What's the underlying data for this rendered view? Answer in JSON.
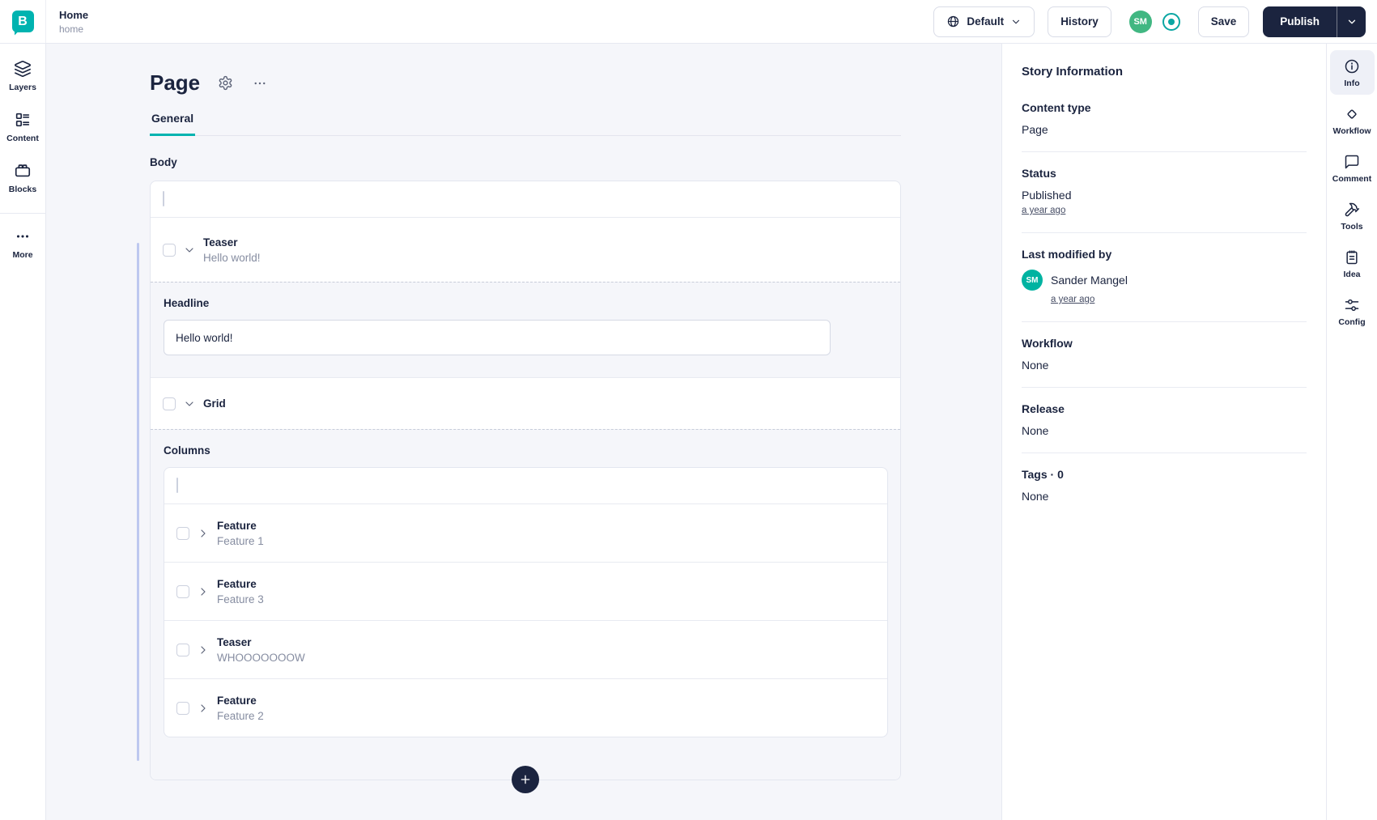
{
  "colors": {
    "brand_teal": "#00b3b0",
    "navy": "#1b243f",
    "avatar_green": "#41b782",
    "avatar_teal": "#00b3a1",
    "main_background": "#f5f6fa",
    "active_tab_underline": "#00b3b0"
  },
  "icons": {
    "topbar": [
      "storyblok-logo",
      "globe-icon",
      "chevron-down-icon",
      "target-icon"
    ],
    "left_rail": [
      "layers-icon",
      "content-icon",
      "blocks-icon",
      "more-icon"
    ],
    "editor": [
      "gear-icon",
      "ellipsis-icon",
      "chevron-down-icon",
      "chevron-right-icon",
      "plus-icon"
    ],
    "right_rail": [
      "info-icon",
      "workflow-icon",
      "comment-icon",
      "tools-icon",
      "idea-icon",
      "config-icon"
    ]
  },
  "topbar": {
    "logo_letter": "B",
    "story_title": "Home",
    "story_slug": "home",
    "language_label": "Default",
    "history_label": "History",
    "avatar_initials": "SM",
    "save_label": "Save",
    "publish_label": "Publish"
  },
  "left_rail": {
    "layers_label": "Layers",
    "content_label": "Content",
    "blocks_label": "Blocks",
    "more_label": "More"
  },
  "editor": {
    "title": "Page",
    "active_tab": "General",
    "body_label": "Body",
    "teaser_block": {
      "title": "Teaser",
      "subtitle": "Hello world!"
    },
    "headline_field": {
      "label": "Headline",
      "value": "Hello world!"
    },
    "grid_block": {
      "title": "Grid"
    },
    "columns_label": "Columns",
    "column_blocks": [
      {
        "title": "Feature",
        "subtitle": "Feature 1"
      },
      {
        "title": "Feature",
        "subtitle": "Feature 3"
      },
      {
        "title": "Teaser",
        "subtitle": "WHOOOOOOOW"
      },
      {
        "title": "Feature",
        "subtitle": "Feature 2"
      }
    ]
  },
  "story_panel": {
    "title": "Story Information",
    "content_type_label": "Content type",
    "content_type_value": "Page",
    "status_label": "Status",
    "status_value": "Published",
    "status_time": "a year ago",
    "modified_label": "Last modified by",
    "modified_avatar": "SM",
    "modified_by": "Sander Mangel",
    "modified_time": "a year ago",
    "workflow_label": "Workflow",
    "workflow_value": "None",
    "release_label": "Release",
    "release_value": "None",
    "tags_label": "Tags · 0",
    "tags_value": "None"
  },
  "right_rail": {
    "info_label": "Info",
    "workflow_label": "Workflow",
    "comment_label": "Comment",
    "tools_label": "Tools",
    "idea_label": "Idea",
    "config_label": "Config"
  }
}
